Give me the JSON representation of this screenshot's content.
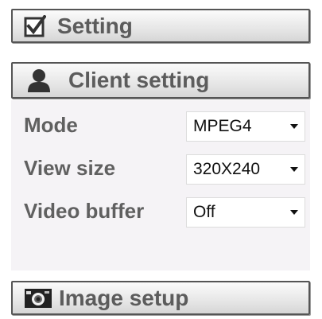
{
  "setting": {
    "label": "Setting",
    "icon": "checkbox-checked-icon"
  },
  "client": {
    "label": "Client setting",
    "icon": "person-icon"
  },
  "fields": [
    {
      "label": "Mode",
      "value": "MPEG4"
    },
    {
      "label": "View size",
      "value": "320X240"
    },
    {
      "label": "Video buffer",
      "value": "Off"
    }
  ],
  "image": {
    "label": "Image setup",
    "icon": "camera-icon"
  },
  "colors": {
    "text": "#5c5c5c",
    "panel": "#f5f3f6"
  }
}
